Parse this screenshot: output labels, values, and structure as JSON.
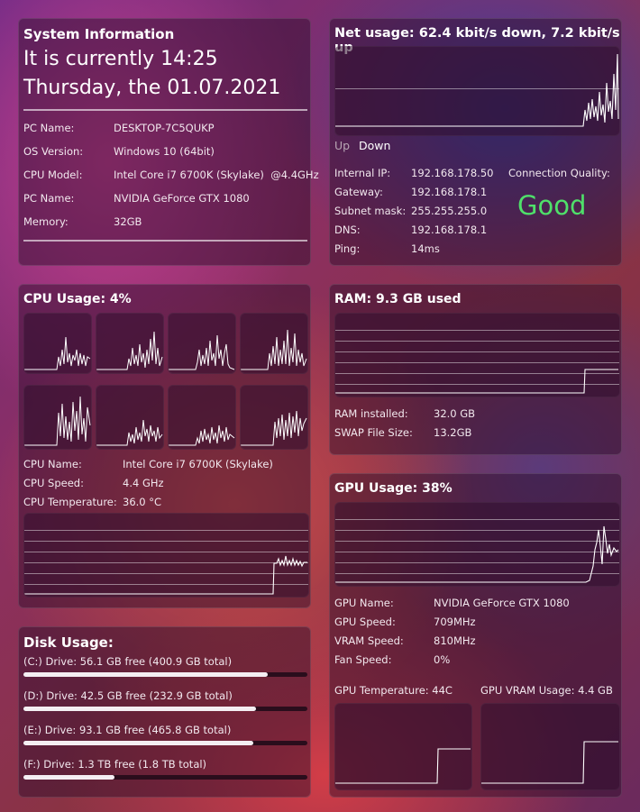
{
  "system": {
    "title": "System Information",
    "time_line": "It is currently 14:25",
    "date_line": "Thursday, the 01.07.2021",
    "rows": [
      {
        "label": "PC Name:",
        "value": "DESKTOP-7C5QUKP"
      },
      {
        "label": "OS Version:",
        "value": "Windows 10 (64bit)"
      },
      {
        "label": "CPU Model:",
        "value": "Intel Core i7 6700K (Skylake)  @4.4GHz"
      },
      {
        "label": "PC Name:",
        "value": "NVIDIA GeForce GTX 1080"
      },
      {
        "label": "Memory:",
        "value": "32GB"
      }
    ]
  },
  "net": {
    "title": "Net usage: 62.4 kbit/s down, 7.2 kbit/s up",
    "legend_up": "Up",
    "legend_down": "Down",
    "rows": [
      {
        "label": "Internal IP:",
        "value": "192.168.178.50"
      },
      {
        "label": "Gateway:",
        "value": "192.168.178.1"
      },
      {
        "label": "Subnet mask:",
        "value": "255.255.255.0"
      },
      {
        "label": "DNS:",
        "value": "192.168.178.1"
      },
      {
        "label": "Ping:",
        "value": "14ms"
      }
    ],
    "quality_label": "Connection Quality:",
    "quality_value": "Good",
    "quality_color": "#4fe06a"
  },
  "cpu": {
    "title": "CPU Usage: 4%",
    "rows": [
      {
        "label": "CPU Name:",
        "value": "Intel Core i7 6700K (Skylake)"
      },
      {
        "label": "CPU Speed:",
        "value": "4.4 GHz"
      },
      {
        "label": "CPU Temperature:",
        "value": "36.0 °C"
      }
    ]
  },
  "ram": {
    "title": "RAM: 9.3 GB used",
    "rows": [
      {
        "label": "RAM installed:",
        "value": "32.0 GB"
      },
      {
        "label": "SWAP File Size:",
        "value": "13.2GB"
      }
    ]
  },
  "disk": {
    "title": "Disk Usage:",
    "drives": [
      {
        "label": "(C:) Drive: 56.1 GB free (400.9 GB total)",
        "used_fraction": 0.86
      },
      {
        "label": "(D:) Drive: 42.5 GB free (232.9 GB total)",
        "used_fraction": 0.82
      },
      {
        "label": "(E:) Drive: 93.1 GB free (465.8 GB total)",
        "used_fraction": 0.81
      },
      {
        "label": "(F:) Drive: 1.3 TB free (1.8 TB total)",
        "used_fraction": 0.32
      }
    ]
  },
  "gpu": {
    "title": "GPU Usage: 38%",
    "rows": [
      {
        "label": "GPU Name:",
        "value": "NVIDIA GeForce GTX 1080"
      },
      {
        "label": "GPU Speed:",
        "value": "709MHz"
      },
      {
        "label": "VRAM Speed:",
        "value": "810MHz"
      },
      {
        "label": "Fan Speed:",
        "value": "0%"
      }
    ],
    "temp_label": "GPU Temperature: 44C",
    "vram_label": "GPU VRAM Usage: 4.4 GB"
  }
}
